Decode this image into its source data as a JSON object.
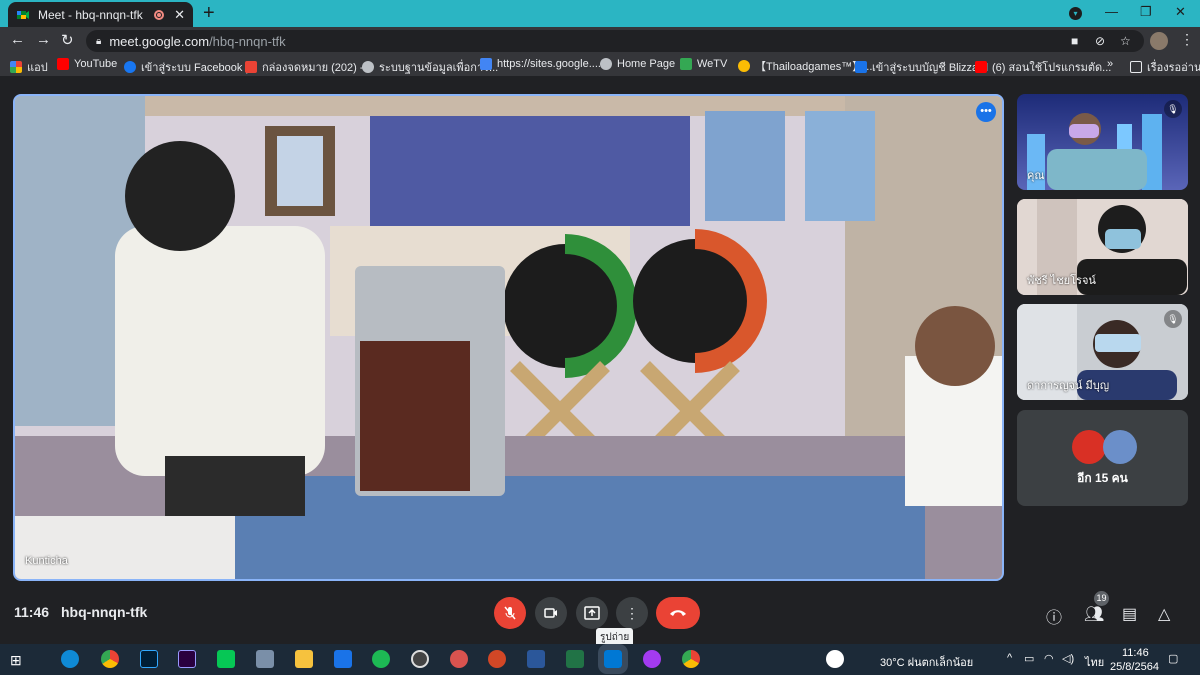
{
  "browser": {
    "tab_title": "Meet - hbq-nnqn-tfk",
    "tab_close": "✕",
    "new_tab": "+",
    "url_host": "meet.google.com",
    "url_path": "/hbq-nnqn-tfk"
  },
  "bookmarks": [
    {
      "label": "แอป",
      "color": "#e8eaed"
    },
    {
      "label": "YouTube",
      "color": "#ff0000"
    },
    {
      "label": "เข้าสู่ระบบ Facebook |...",
      "color": "#1877f2"
    },
    {
      "label": "กล่องจดหมาย (202) -...",
      "color": "#ea4335"
    },
    {
      "label": "ระบบฐานข้อมูลเพื่อการ...",
      "color": "#bdc1c6"
    },
    {
      "label": "https://sites.google....",
      "color": "#4285f4"
    },
    {
      "label": "Home Page",
      "color": "#bdc1c6"
    },
    {
      "label": "WeTV",
      "color": "#34a853"
    },
    {
      "label": "【Thailoadgames™】...",
      "color": "#fbbc04"
    },
    {
      "label": "เข้าสู่ระบบบัญชี Blizzard",
      "color": "#1a73e8"
    },
    {
      "label": "(6) สอนใช้โปรแกรมตัด...",
      "color": "#ff0000"
    }
  ],
  "bookmarks_more": "»",
  "reading_list": "เรื่องรออ่าน",
  "meet": {
    "main_speaker": "Kunticha",
    "participants": [
      {
        "name": "คุณ"
      },
      {
        "name": "พัชรี ไชยโรจน์"
      },
      {
        "name": "ดาการญจน์ มีบุญ"
      }
    ],
    "others_label": "อีก 15 คน",
    "time": "11:46",
    "meeting_code": "hbq-nnqn-tfk",
    "tooltip": "รูปถ่าย",
    "people_count": "19"
  },
  "taskbar": {
    "weather": "30°C  ฝนตกเล็กน้อย",
    "lang": "ไทย",
    "clock_time": "11:46",
    "clock_date": "25/8/2564"
  }
}
